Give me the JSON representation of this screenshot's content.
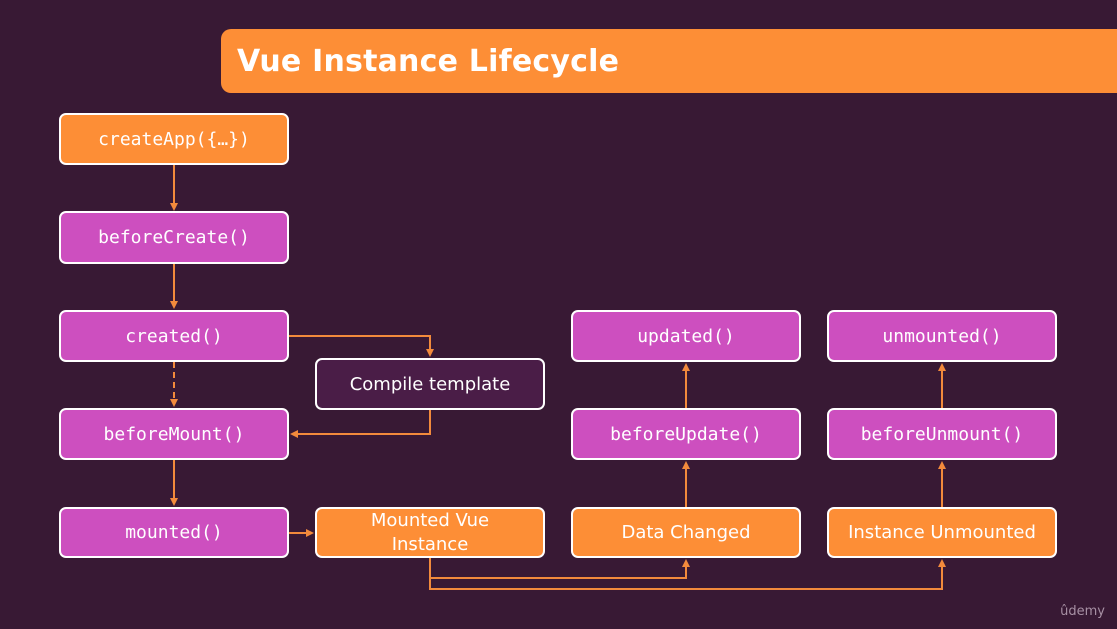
{
  "title": "Vue Instance Lifecycle",
  "colors": {
    "background": "#381934",
    "accent_orange": "#fd8e36",
    "hook_magenta": "#cd4fbf",
    "compile_dark": "#4a1d47",
    "connector": "#f28a3c",
    "border": "#ffffff"
  },
  "nodes": {
    "createApp": "createApp({…})",
    "beforeCreate": "beforeCreate()",
    "created": "created()",
    "compileTemplate": "Compile template",
    "beforeMount": "beforeMount()",
    "mounted": "mounted()",
    "mountedInstance": "Mounted Vue Instance",
    "dataChanged": "Data Changed",
    "beforeUpdate": "beforeUpdate()",
    "updated": "updated()",
    "instanceUnmounted": "Instance Unmounted",
    "beforeUnmount": "beforeUnmount()",
    "unmounted": "unmounted()"
  },
  "edges": [
    {
      "from": "createApp",
      "to": "beforeCreate",
      "style": "solid"
    },
    {
      "from": "beforeCreate",
      "to": "created",
      "style": "solid"
    },
    {
      "from": "created",
      "to": "compileTemplate",
      "style": "solid"
    },
    {
      "from": "created",
      "to": "beforeMount",
      "style": "dashed"
    },
    {
      "from": "compileTemplate",
      "to": "beforeMount",
      "style": "solid"
    },
    {
      "from": "beforeMount",
      "to": "mounted",
      "style": "solid"
    },
    {
      "from": "mounted",
      "to": "mountedInstance",
      "style": "solid"
    },
    {
      "from": "mountedInstance",
      "to": "dataChanged",
      "style": "solid"
    },
    {
      "from": "mountedInstance",
      "to": "instanceUnmounted",
      "style": "solid"
    },
    {
      "from": "dataChanged",
      "to": "beforeUpdate",
      "style": "solid"
    },
    {
      "from": "beforeUpdate",
      "to": "updated",
      "style": "solid"
    },
    {
      "from": "instanceUnmounted",
      "to": "beforeUnmount",
      "style": "solid"
    },
    {
      "from": "beforeUnmount",
      "to": "unmounted",
      "style": "solid"
    }
  ],
  "watermark": "ûdemy"
}
